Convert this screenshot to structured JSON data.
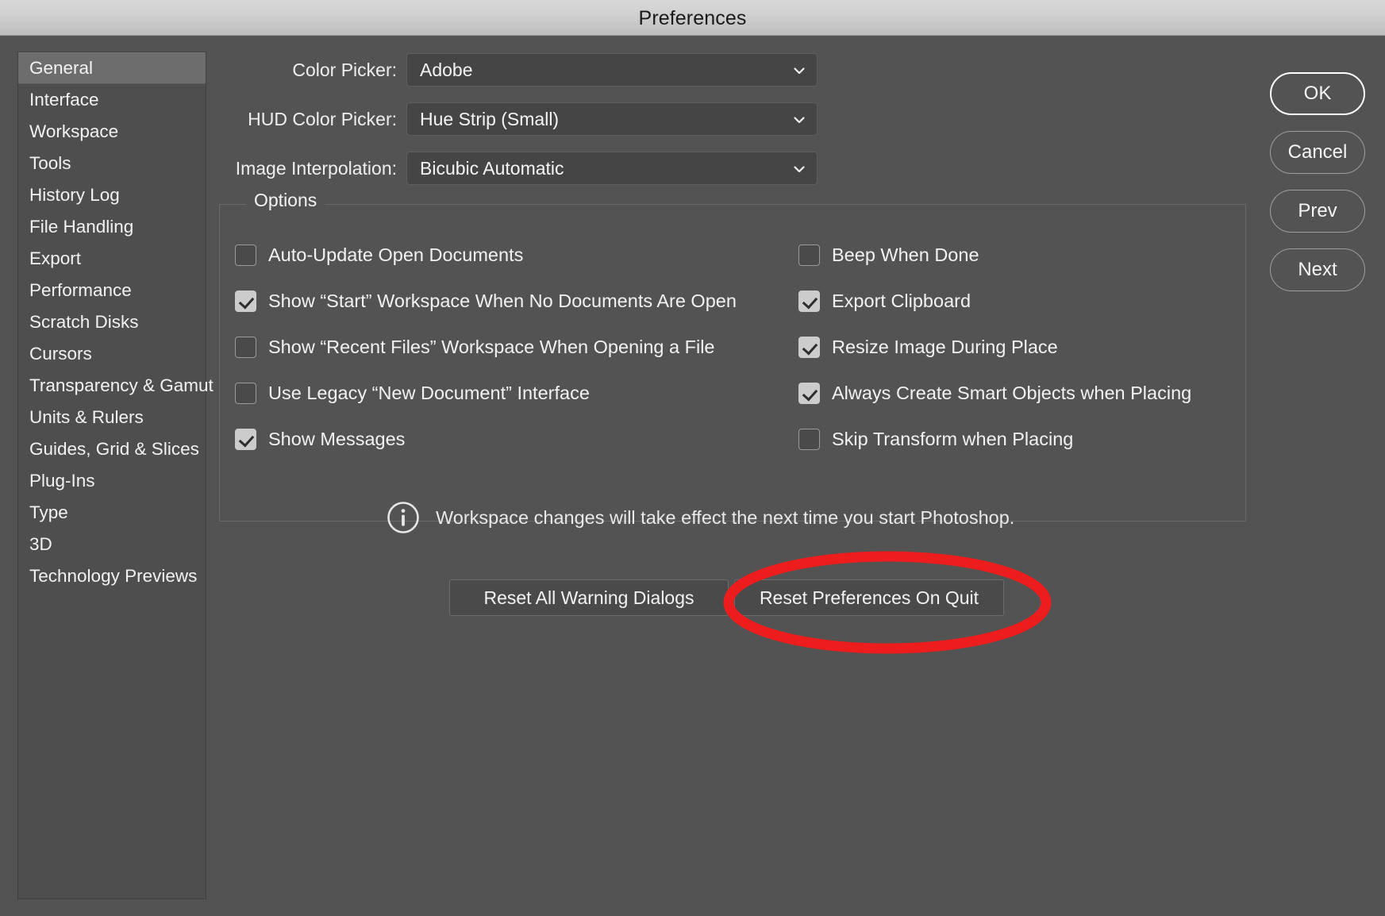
{
  "window": {
    "title": "Preferences"
  },
  "sidebar": {
    "items": [
      {
        "label": "General",
        "selected": true
      },
      {
        "label": "Interface",
        "selected": false
      },
      {
        "label": "Workspace",
        "selected": false
      },
      {
        "label": "Tools",
        "selected": false
      },
      {
        "label": "History Log",
        "selected": false
      },
      {
        "label": "File Handling",
        "selected": false
      },
      {
        "label": "Export",
        "selected": false
      },
      {
        "label": "Performance",
        "selected": false
      },
      {
        "label": "Scratch Disks",
        "selected": false
      },
      {
        "label": "Cursors",
        "selected": false
      },
      {
        "label": "Transparency & Gamut",
        "selected": false
      },
      {
        "label": "Units & Rulers",
        "selected": false
      },
      {
        "label": "Guides, Grid & Slices",
        "selected": false
      },
      {
        "label": "Plug-Ins",
        "selected": false
      },
      {
        "label": "Type",
        "selected": false
      },
      {
        "label": "3D",
        "selected": false
      },
      {
        "label": "Technology Previews",
        "selected": false
      }
    ]
  },
  "fields": [
    {
      "label": "Color Picker:",
      "value": "Adobe",
      "icon": "chevron-down-icon"
    },
    {
      "label": "HUD Color Picker:",
      "value": "Hue Strip (Small)",
      "icon": "chevron-down-icon"
    },
    {
      "label": "Image Interpolation:",
      "value": "Bicubic Automatic",
      "icon": "chevron-down-icon"
    }
  ],
  "options": {
    "legend": "Options",
    "left_column": [
      {
        "label": "Auto-Update Open Documents",
        "checked": false
      },
      {
        "label": "Show “Start” Workspace When No Documents Are Open",
        "checked": true
      },
      {
        "label": "Show “Recent Files” Workspace When Opening a File",
        "checked": false
      },
      {
        "label": "Use Legacy “New Document” Interface",
        "checked": false
      },
      {
        "label": "Show Messages",
        "checked": true
      }
    ],
    "right_column": [
      {
        "label": "Beep When Done",
        "checked": false
      },
      {
        "label": "Export Clipboard",
        "checked": true
      },
      {
        "label": "Resize Image During Place",
        "checked": true
      },
      {
        "label": "Always Create Smart Objects when Placing",
        "checked": true
      },
      {
        "label": "Skip Transform when Placing",
        "checked": false
      }
    ],
    "note": {
      "icon": "info-circle-icon",
      "text": "Workspace changes will take effect the next time you start Photoshop."
    }
  },
  "reset_buttons": [
    {
      "label": "Reset All Warning Dialogs"
    },
    {
      "label": "Reset Preferences On Quit"
    }
  ],
  "actions": [
    {
      "label": "OK",
      "is_default": true
    },
    {
      "label": "Cancel",
      "is_default": false
    },
    {
      "label": "Prev",
      "is_default": false
    },
    {
      "label": "Next",
      "is_default": false
    }
  ],
  "annotation": {
    "shape": "ellipse",
    "color": "#ee1d1d",
    "target": "Reset Preferences On Quit"
  },
  "colors": {
    "dialog_background": "#535353",
    "titlebar": "#cfcfcf",
    "sidebar_panel": "#4e4e4e",
    "sidebar_selected": "#6d6d6d",
    "control_fill": "#454545",
    "text": "#f2f2f2",
    "annotation_red": "#ee1d1d"
  }
}
